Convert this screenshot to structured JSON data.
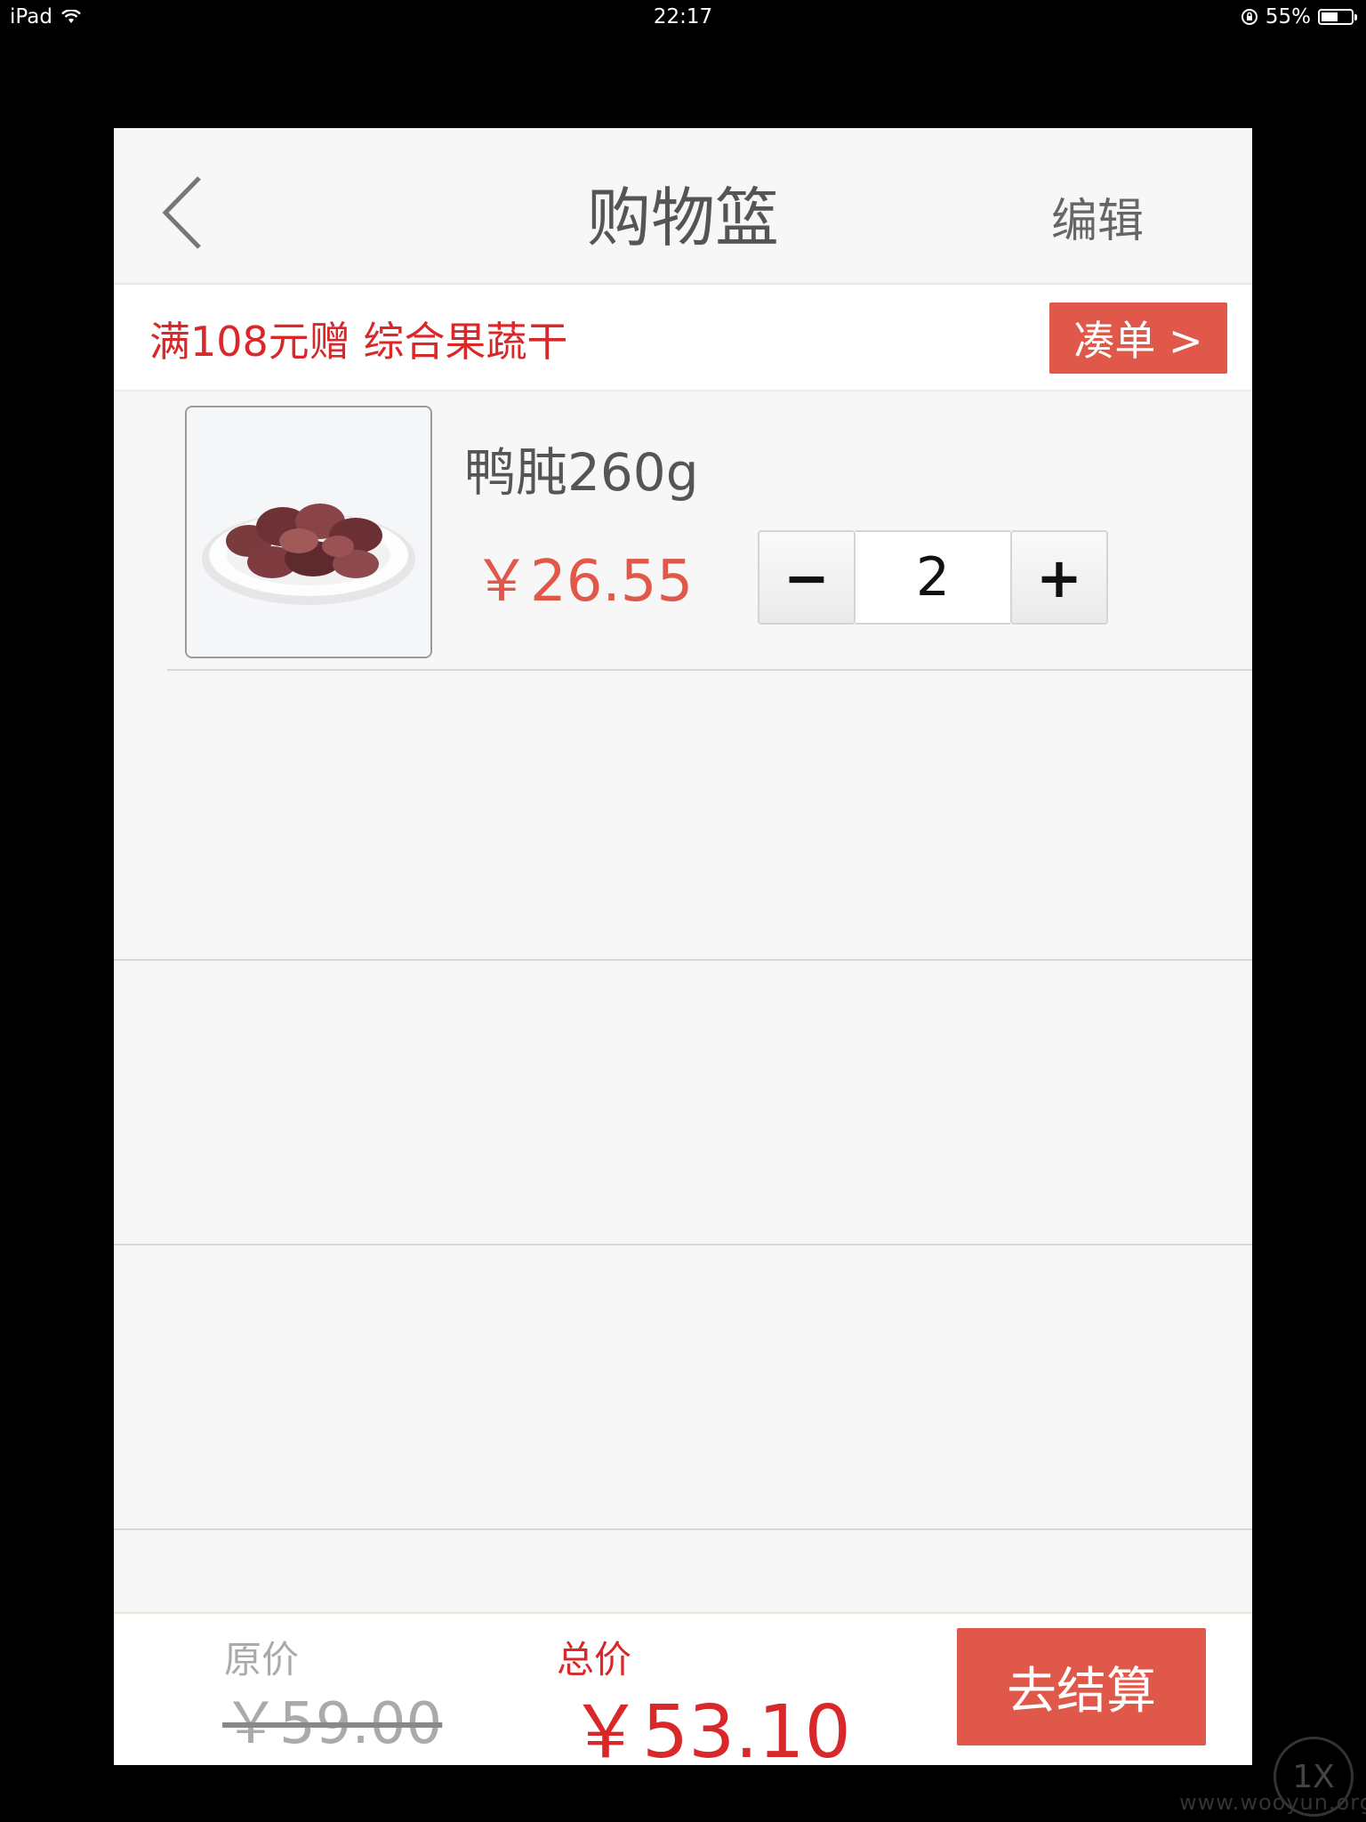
{
  "status_bar": {
    "device": "iPad",
    "time": "22:17",
    "battery_percent": "55%",
    "battery_level": 0.55
  },
  "nav": {
    "title": "购物篮",
    "edit_label": "编辑",
    "back_icon": "chevron-left-icon"
  },
  "promo": {
    "text": "满108元赠 综合果蔬干",
    "button_label": "凑单 >"
  },
  "cart": {
    "items": [
      {
        "name": "鸭肫260g",
        "price": "￥26.55",
        "quantity": "2",
        "minus_label": "−",
        "plus_label": "+",
        "image_icon": "duck-gizzard-photo"
      }
    ]
  },
  "footer": {
    "original_label": "原价",
    "original_price": "￥59.00",
    "total_label": "总价",
    "total_price": "￥53.10",
    "checkout_label": "去结算"
  },
  "watermark": {
    "badge": "1X",
    "site": "www.wooyun.org"
  },
  "colors": {
    "accent": "#e0584a",
    "price_red": "#d8282a",
    "background": "#f7f7f7"
  }
}
